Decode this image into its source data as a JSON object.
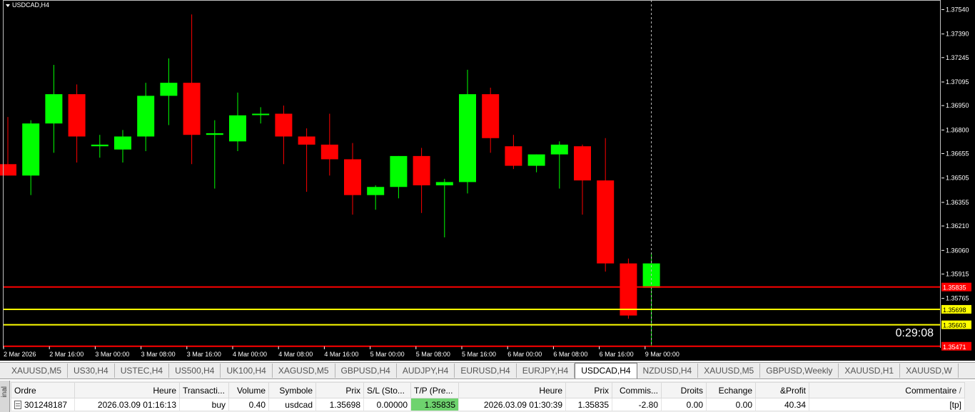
{
  "chart": {
    "title": "USDCAD,H4",
    "timer": "0:29:08",
    "colors": {
      "bull": "#00ff00",
      "bear": "#ff0000",
      "background": "#000000",
      "axis_text": "#ffffff"
    },
    "price_axis": [
      "1.37540",
      "1.37390",
      "1.37245",
      "1.37095",
      "1.36950",
      "1.36800",
      "1.36655",
      "1.36505",
      "1.36355",
      "1.36210",
      "1.36060",
      "1.35915",
      "1.35765"
    ],
    "time_axis": [
      "2 Mar 2026",
      "2 Mar 16:00",
      "3 Mar 00:00",
      "3 Mar 08:00",
      "3 Mar 16:00",
      "4 Mar 00:00",
      "4 Mar 08:00",
      "4 Mar 16:00",
      "5 Mar 00:00",
      "5 Mar 08:00",
      "5 Mar 16:00",
      "6 Mar 00:00",
      "6 Mar 08:00",
      "6 Mar 16:00",
      "9 Mar 00:00"
    ],
    "lines": [
      {
        "name": "tp-line",
        "price": 1.35835,
        "label": "1.35835",
        "color": "#ff0000",
        "label_bg": "#ff0000",
        "label_fg": "#ffffff"
      },
      {
        "name": "open-price-line",
        "price": 1.35698,
        "label": "1.35698",
        "color": "#ffff00",
        "label_bg": "#ffff00",
        "label_fg": "#000000"
      },
      {
        "name": "bid-line",
        "price": 1.35603,
        "label": "1.35603",
        "color": "#ffff00",
        "label_bg": "#ffff00",
        "label_fg": "#000000"
      },
      {
        "name": "sl-line",
        "price": 1.35471,
        "label": "1.35471",
        "color": "#ff0000",
        "label_bg": "#ff0000",
        "label_fg": "#ffffff"
      }
    ]
  },
  "chart_data": {
    "type": "candlestick",
    "title": "USDCAD,H4",
    "ylim": [
      1.3547,
      1.3759
    ],
    "candles": [
      {
        "o": 1.3659,
        "h": 1.3688,
        "l": 1.3652,
        "c": 1.3652
      },
      {
        "o": 1.3652,
        "h": 1.3686,
        "l": 1.364,
        "c": 1.3684
      },
      {
        "o": 1.3684,
        "h": 1.372,
        "l": 1.3666,
        "c": 1.3702
      },
      {
        "o": 1.3702,
        "h": 1.3708,
        "l": 1.366,
        "c": 1.3676
      },
      {
        "o": 1.367,
        "h": 1.3677,
        "l": 1.3663,
        "c": 1.3671
      },
      {
        "o": 1.3668,
        "h": 1.368,
        "l": 1.366,
        "c": 1.3676
      },
      {
        "o": 1.3676,
        "h": 1.3709,
        "l": 1.3667,
        "c": 1.3701
      },
      {
        "o": 1.3701,
        "h": 1.3724,
        "l": 1.3683,
        "c": 1.3709
      },
      {
        "o": 1.3709,
        "h": 1.3751,
        "l": 1.3659,
        "c": 1.3677
      },
      {
        "o": 1.3677,
        "h": 1.3686,
        "l": 1.3644,
        "c": 1.3678
      },
      {
        "o": 1.3673,
        "h": 1.3703,
        "l": 1.3667,
        "c": 1.3689
      },
      {
        "o": 1.369,
        "h": 1.3694,
        "l": 1.3684,
        "c": 1.369
      },
      {
        "o": 1.369,
        "h": 1.3695,
        "l": 1.3659,
        "c": 1.3676
      },
      {
        "o": 1.3676,
        "h": 1.3681,
        "l": 1.3642,
        "c": 1.3671
      },
      {
        "o": 1.3671,
        "h": 1.369,
        "l": 1.3652,
        "c": 1.3662
      },
      {
        "o": 1.3662,
        "h": 1.3672,
        "l": 1.3628,
        "c": 1.364
      },
      {
        "o": 1.364,
        "h": 1.3646,
        "l": 1.3631,
        "c": 1.3645
      },
      {
        "o": 1.3645,
        "h": 1.3664,
        "l": 1.3638,
        "c": 1.3664
      },
      {
        "o": 1.3664,
        "h": 1.3669,
        "l": 1.3629,
        "c": 1.3646
      },
      {
        "o": 1.3646,
        "h": 1.365,
        "l": 1.3614,
        "c": 1.3648
      },
      {
        "o": 1.3648,
        "h": 1.3717,
        "l": 1.3641,
        "c": 1.3702
      },
      {
        "o": 1.3702,
        "h": 1.3706,
        "l": 1.3666,
        "c": 1.3675
      },
      {
        "o": 1.367,
        "h": 1.3677,
        "l": 1.3656,
        "c": 1.3658
      },
      {
        "o": 1.3658,
        "h": 1.3665,
        "l": 1.3654,
        "c": 1.3665
      },
      {
        "o": 1.3665,
        "h": 1.3673,
        "l": 1.3644,
        "c": 1.3671
      },
      {
        "o": 1.367,
        "h": 1.3671,
        "l": 1.3628,
        "c": 1.3649
      },
      {
        "o": 1.3649,
        "h": 1.3675,
        "l": 1.3593,
        "c": 1.3598
      },
      {
        "o": 1.3598,
        "h": 1.3601,
        "l": 1.3564,
        "c": 1.3566
      },
      {
        "o": 1.3583,
        "h": 1.3604,
        "l": 1.3547,
        "c": 1.3598
      }
    ],
    "current_bar_marker": "9 Mar 00:00"
  },
  "symbol_tabs": [
    {
      "label": "XAUUSD,M5",
      "active": false
    },
    {
      "label": "US30,H4",
      "active": false
    },
    {
      "label": "USTEC,H4",
      "active": false
    },
    {
      "label": "US500,H4",
      "active": false
    },
    {
      "label": "UK100,H4",
      "active": false
    },
    {
      "label": "XAGUSD,M5",
      "active": false
    },
    {
      "label": "GBPUSD,H4",
      "active": false
    },
    {
      "label": "AUDJPY,H4",
      "active": false
    },
    {
      "label": "EURUSD,H4",
      "active": false
    },
    {
      "label": "EURJPY,H4",
      "active": false
    },
    {
      "label": "USDCAD,H4",
      "active": true
    },
    {
      "label": "NZDUSD,H4",
      "active": false
    },
    {
      "label": "XAUUSD,M5",
      "active": false
    },
    {
      "label": "GBPUSD,Weekly",
      "active": false
    },
    {
      "label": "XAUUSD,H1",
      "active": false
    },
    {
      "label": "XAUUSD,W",
      "active": false
    }
  ],
  "terminal": {
    "side_label": "inal",
    "columns": {
      "ordre": "Ordre",
      "heure": "Heure",
      "transaction": "Transacti...",
      "volume": "Volume",
      "symbole": "Symbole",
      "prix": "Prix",
      "sl": "S/L (Sto...",
      "tp": "T/P (Pre...",
      "heure2": "Heure",
      "prix2": "Prix",
      "commission": "Commis...",
      "droits": "Droits",
      "echange": "Echange",
      "profit": "&Profit",
      "commentaire": "Commentaire",
      "sort_marker": "/"
    },
    "row": {
      "ordre": "301248187",
      "heure": "2026.03.09 01:16:13",
      "transaction": "buy",
      "volume": "0.40",
      "symbole": "usdcad",
      "prix": "1.35698",
      "sl": "0.00000",
      "tp": "1.35835",
      "heure2": "2026.03.09 01:30:39",
      "prix2": "1.35835",
      "commission": "-2.80",
      "droits": "0.00",
      "echange": "0.00",
      "profit": "40.34",
      "commentaire": "[tp]"
    }
  }
}
